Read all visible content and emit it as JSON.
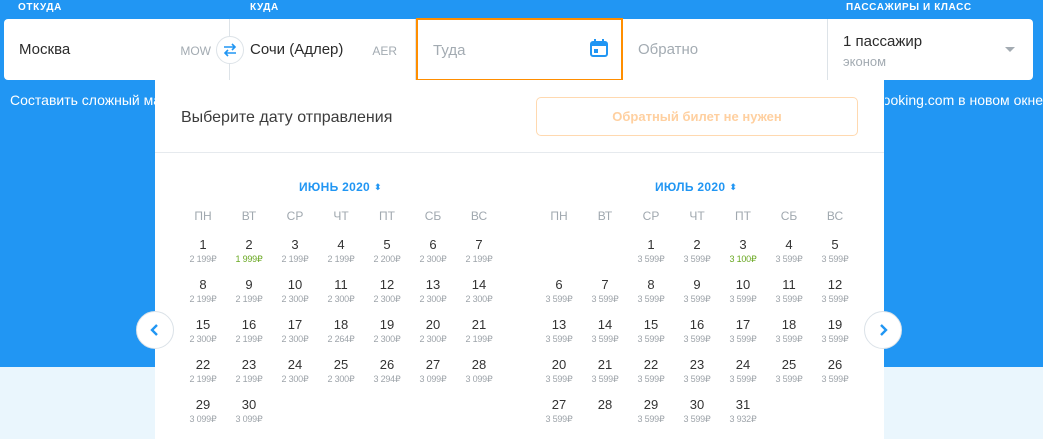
{
  "labels": {
    "from": "ОТКУДА",
    "to": "КУДА",
    "pax": "ПАССАЖИРЫ И КЛАСС"
  },
  "search": {
    "from_city": "Москва",
    "from_iata": "MOW",
    "to_city": "Сочи (Адлер)",
    "to_iata": "AER",
    "depart_placeholder": "Туда",
    "return_placeholder": "Обратно",
    "pax_count": "1 пассажир",
    "pax_class": "эконом"
  },
  "links": {
    "complex_route": "Составить сложный маршрут",
    "booking": "Открыть Booking.com в новом окне"
  },
  "calendar": {
    "title": "Выберите дату отправления",
    "no_return_button": "Обратный билет не нужен",
    "weekdays": [
      "ПН",
      "ВТ",
      "СР",
      "ЧТ",
      "ПТ",
      "СБ",
      "ВС"
    ],
    "months": [
      {
        "title": "ИЮНЬ 2020",
        "offset": 0,
        "days": [
          {
            "d": "1",
            "p": "2 199₽"
          },
          {
            "d": "2",
            "p": "1 999₽",
            "low": true
          },
          {
            "d": "3",
            "p": "2 199₽"
          },
          {
            "d": "4",
            "p": "2 199₽"
          },
          {
            "d": "5",
            "p": "2 200₽"
          },
          {
            "d": "6",
            "p": "2 300₽"
          },
          {
            "d": "7",
            "p": "2 199₽"
          },
          {
            "d": "8",
            "p": "2 199₽"
          },
          {
            "d": "9",
            "p": "2 199₽"
          },
          {
            "d": "10",
            "p": "2 300₽"
          },
          {
            "d": "11",
            "p": "2 300₽"
          },
          {
            "d": "12",
            "p": "2 300₽"
          },
          {
            "d": "13",
            "p": "2 300₽"
          },
          {
            "d": "14",
            "p": "2 300₽"
          },
          {
            "d": "15",
            "p": "2 300₽"
          },
          {
            "d": "16",
            "p": "2 199₽"
          },
          {
            "d": "17",
            "p": "2 300₽"
          },
          {
            "d": "18",
            "p": "2 264₽"
          },
          {
            "d": "19",
            "p": "2 300₽"
          },
          {
            "d": "20",
            "p": "2 300₽"
          },
          {
            "d": "21",
            "p": "2 199₽"
          },
          {
            "d": "22",
            "p": "2 199₽"
          },
          {
            "d": "23",
            "p": "2 199₽"
          },
          {
            "d": "24",
            "p": "2 300₽"
          },
          {
            "d": "25",
            "p": "2 300₽"
          },
          {
            "d": "26",
            "p": "3 294₽"
          },
          {
            "d": "27",
            "p": "3 099₽"
          },
          {
            "d": "28",
            "p": "3 099₽"
          },
          {
            "d": "29",
            "p": "3 099₽"
          },
          {
            "d": "30",
            "p": "3 099₽"
          }
        ]
      },
      {
        "title": "ИЮЛЬ 2020",
        "offset": 2,
        "days": [
          {
            "d": "1",
            "p": "3 599₽"
          },
          {
            "d": "2",
            "p": "3 599₽"
          },
          {
            "d": "3",
            "p": "3 100₽",
            "low": true
          },
          {
            "d": "4",
            "p": "3 599₽"
          },
          {
            "d": "5",
            "p": "3 599₽"
          },
          {
            "d": "6",
            "p": "3 599₽"
          },
          {
            "d": "7",
            "p": "3 599₽"
          },
          {
            "d": "8",
            "p": "3 599₽"
          },
          {
            "d": "9",
            "p": "3 599₽"
          },
          {
            "d": "10",
            "p": "3 599₽"
          },
          {
            "d": "11",
            "p": "3 599₽"
          },
          {
            "d": "12",
            "p": "3 599₽"
          },
          {
            "d": "13",
            "p": "3 599₽"
          },
          {
            "d": "14",
            "p": "3 599₽"
          },
          {
            "d": "15",
            "p": "3 599₽"
          },
          {
            "d": "16",
            "p": "3 599₽"
          },
          {
            "d": "17",
            "p": "3 599₽"
          },
          {
            "d": "18",
            "p": "3 599₽"
          },
          {
            "d": "19",
            "p": "3 599₽"
          },
          {
            "d": "20",
            "p": "3 599₽"
          },
          {
            "d": "21",
            "p": "3 599₽"
          },
          {
            "d": "22",
            "p": "3 599₽"
          },
          {
            "d": "23",
            "p": "3 599₽"
          },
          {
            "d": "24",
            "p": "3 599₽"
          },
          {
            "d": "25",
            "p": "3 599₽"
          },
          {
            "d": "26",
            "p": "3 599₽"
          },
          {
            "d": "27",
            "p": "3 599₽"
          },
          {
            "d": "28",
            "p": ""
          },
          {
            "d": "29",
            "p": "3 599₽"
          },
          {
            "d": "30",
            "p": "3 599₽"
          },
          {
            "d": "31",
            "p": "3 932₽"
          }
        ]
      }
    ]
  },
  "icons": {
    "swap": "swap-icon",
    "calendar": "calendar-icon",
    "route": "route-icon",
    "prev": "chevron-left-icon",
    "next": "chevron-right-icon"
  },
  "colors": {
    "primary": "#2196f3",
    "accent": "#ff8e00",
    "low_price": "#6aa823"
  }
}
